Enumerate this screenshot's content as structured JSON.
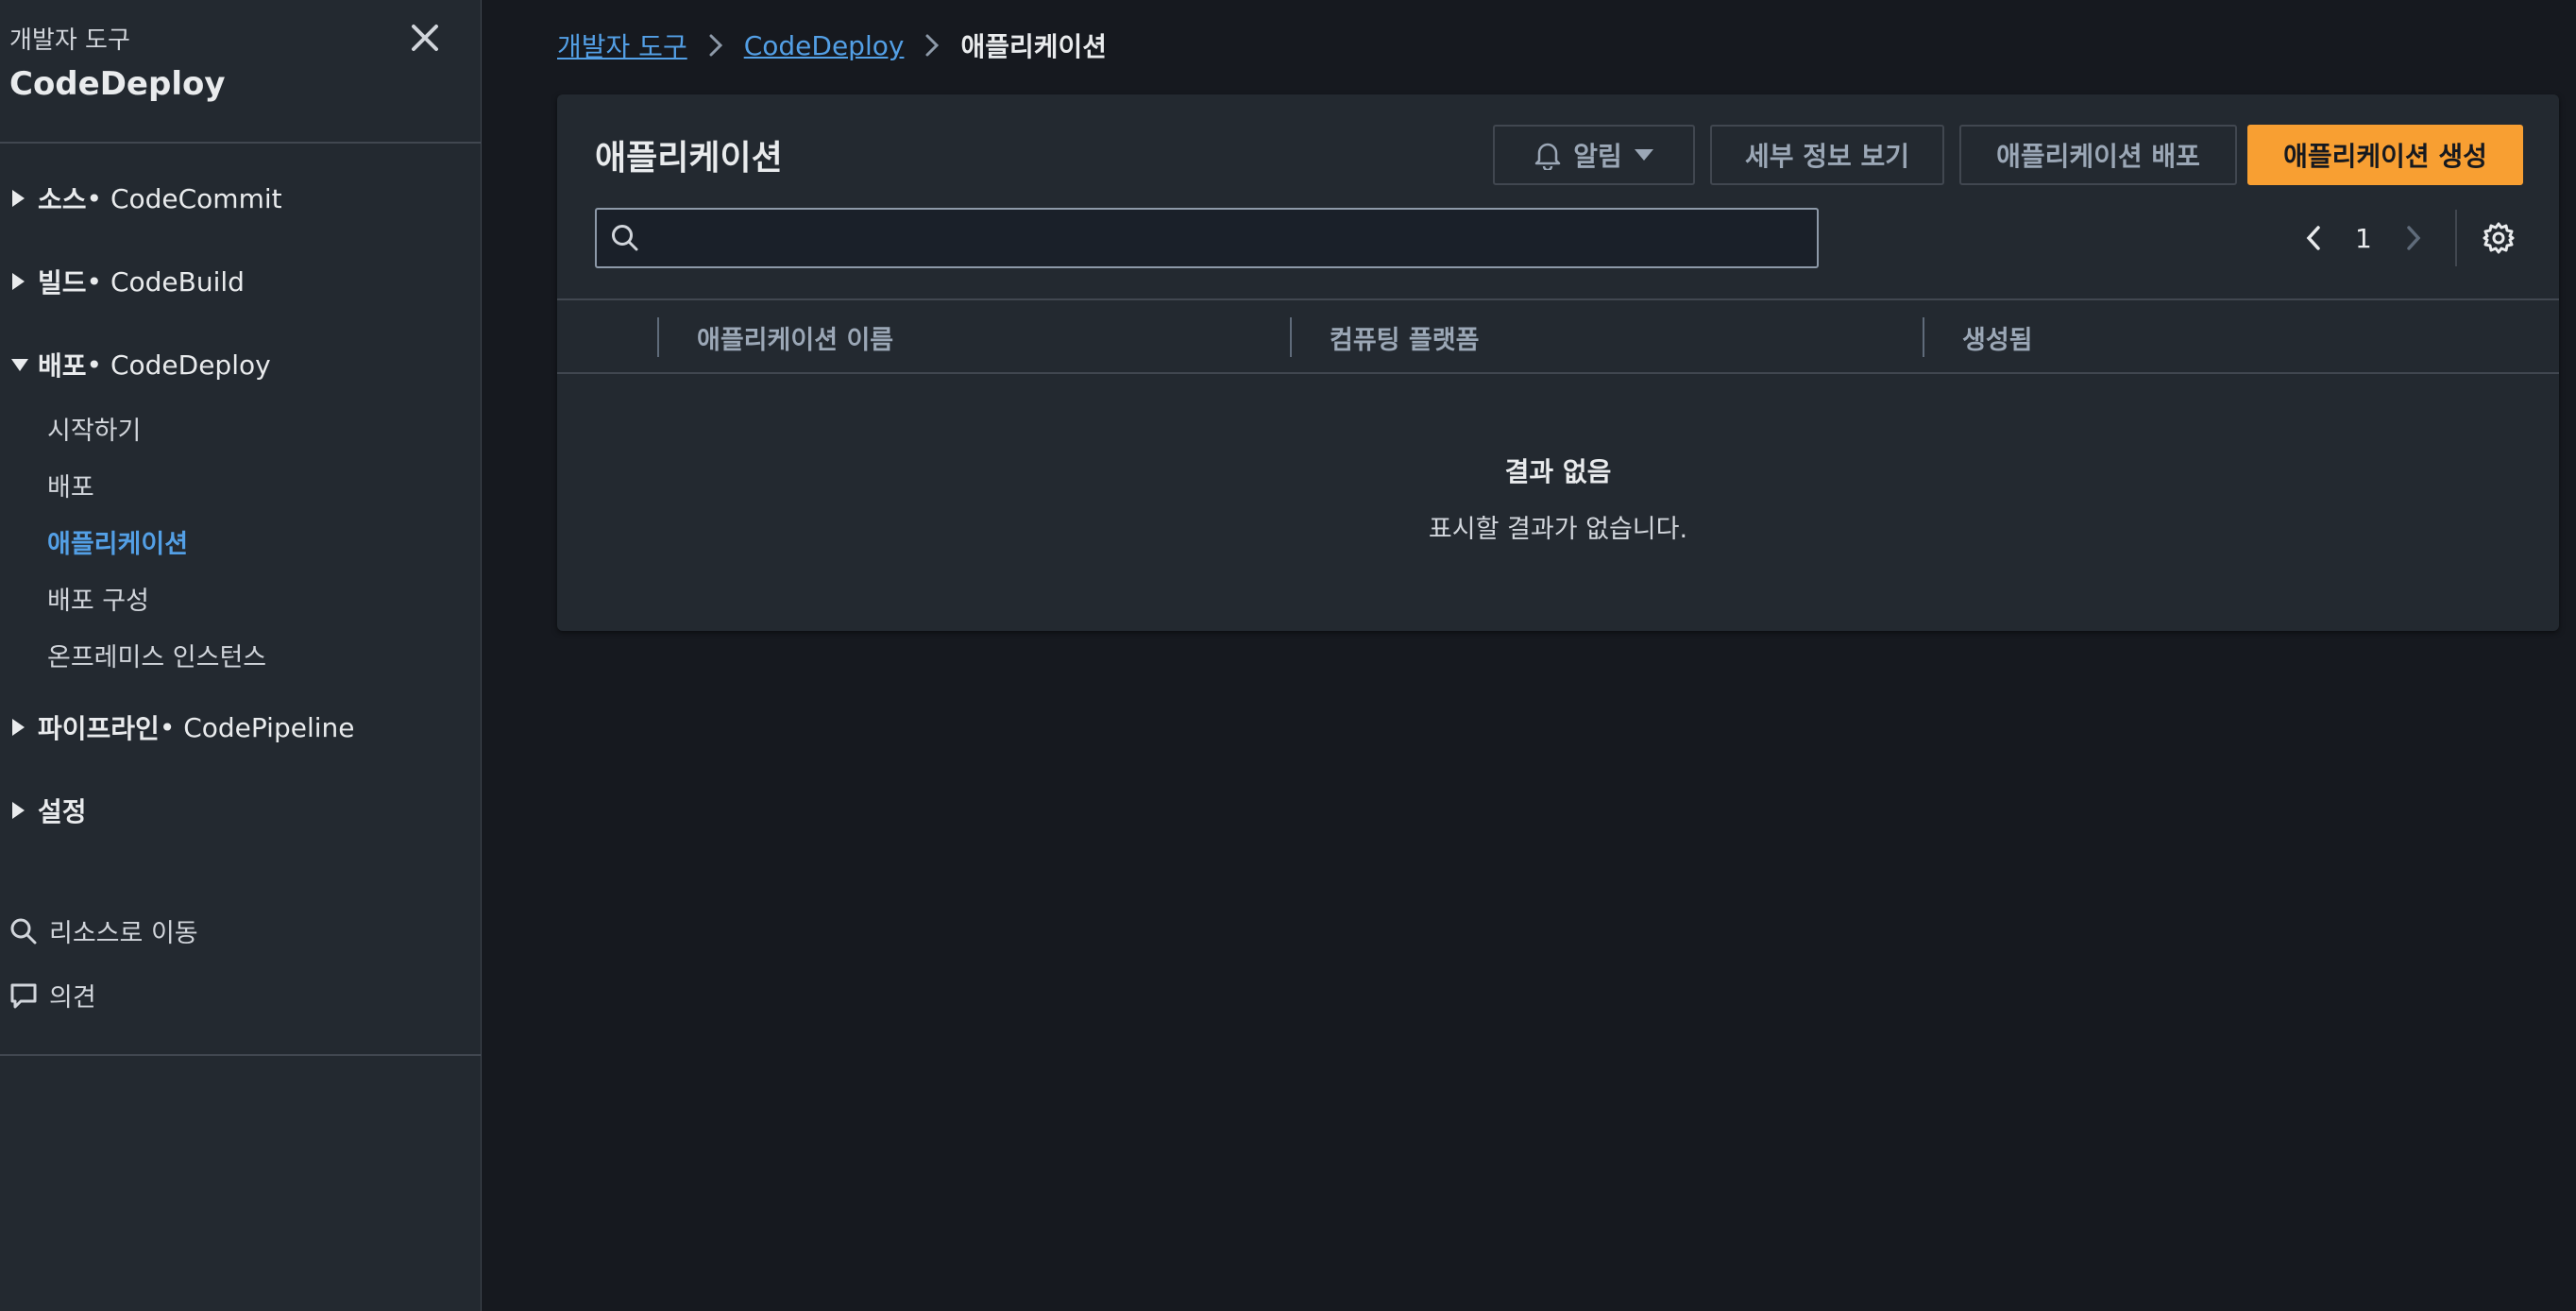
{
  "sidebar": {
    "supertitle": "개발자 도구",
    "title": "CodeDeploy",
    "sections": [
      {
        "prefix": "소스",
        "service": " • CodeCommit",
        "expanded": false
      },
      {
        "prefix": "빌드",
        "service": " • CodeBuild",
        "expanded": false
      },
      {
        "prefix": "배포",
        "service": " • CodeDeploy",
        "expanded": true
      },
      {
        "prefix": "파이프라인",
        "service": " • CodePipeline",
        "expanded": false
      },
      {
        "prefix": "설정",
        "service": "",
        "expanded": false
      }
    ],
    "deploy_items": [
      "시작하기",
      "배포",
      "애플리케이션",
      "배포 구성",
      "온프레미스 인스턴스"
    ],
    "active_item": "애플리케이션",
    "tools": {
      "goto_resource": "리소스로 이동",
      "feedback": "의견"
    }
  },
  "breadcrumb": {
    "items": [
      "개발자 도구",
      "CodeDeploy"
    ],
    "current": "애플리케이션"
  },
  "panel": {
    "title": "애플리케이션",
    "buttons": {
      "notify": "알림",
      "view_details": "세부 정보 보기",
      "deploy_app": "애플리케이션 배포",
      "create_app": "애플리케이션 생성"
    },
    "search": {
      "value": "",
      "placeholder": ""
    },
    "pagination": {
      "current_page": "1"
    },
    "columns": [
      "애플리케이션 이름",
      "컴퓨팅 플랫폼",
      "생성됨"
    ],
    "empty": {
      "title": "결과 없음",
      "subtitle": "표시할 결과가 없습니다."
    }
  },
  "colors": {
    "background": "#16191f",
    "panel": "#232930",
    "link": "#539fe5",
    "primary": "#f89f32"
  }
}
